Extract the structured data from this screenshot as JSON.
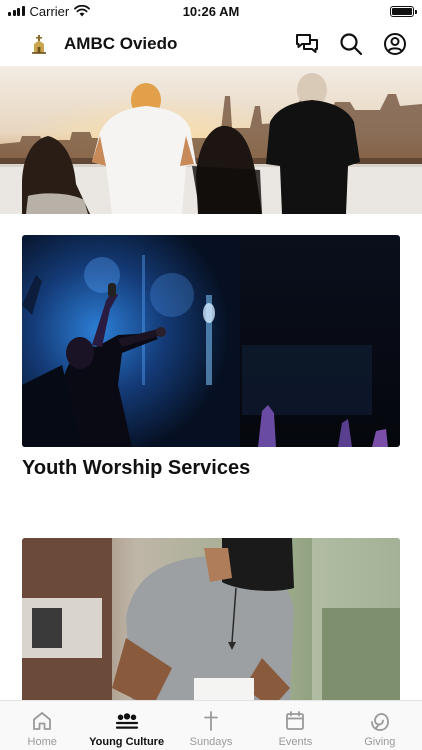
{
  "status_bar": {
    "carrier": "Carrier",
    "time": "10:26 AM",
    "battery_level": 1.0
  },
  "header": {
    "title": "AMBC Oviedo",
    "logo_icon": "church-logo-icon",
    "icons": [
      "chat-bubbles-icon",
      "search-icon",
      "profile-icon"
    ]
  },
  "cards": [
    {
      "title": "Youth Worship Services"
    }
  ],
  "tab_bar": {
    "items": [
      {
        "label": "Home",
        "icon": "home-icon",
        "active": false
      },
      {
        "label": "Young Culture",
        "icon": "group-icon",
        "active": true
      },
      {
        "label": "Sundays",
        "icon": "cross-icon",
        "active": false
      },
      {
        "label": "Events",
        "icon": "calendar-icon",
        "active": false
      },
      {
        "label": "Giving",
        "icon": "giving-icon",
        "active": false
      }
    ]
  },
  "colors": {
    "active_tab": "#111111",
    "inactive_tab": "#9a9a9a",
    "tab_bar_bg": "#f9f9f9"
  }
}
